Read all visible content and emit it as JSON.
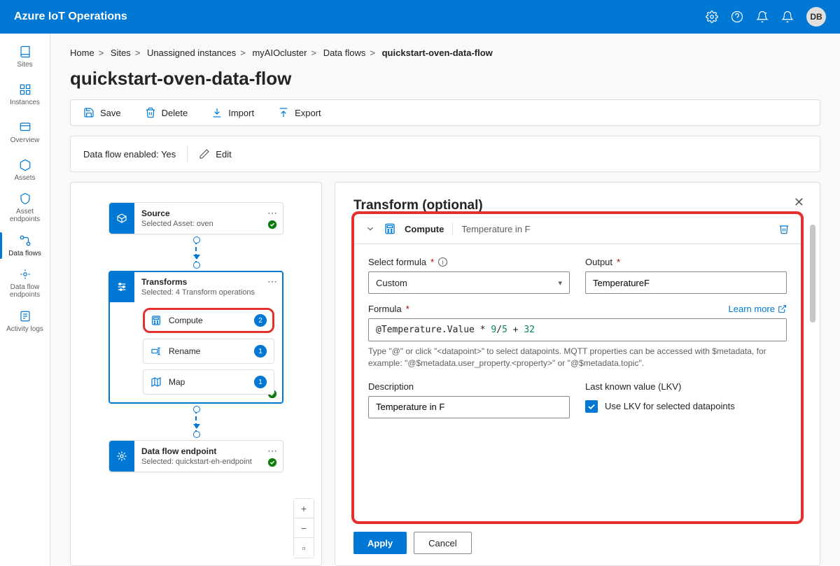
{
  "app_title": "Azure IoT Operations",
  "avatar_initials": "DB",
  "nav": [
    {
      "label": "Sites",
      "icon": "book"
    },
    {
      "label": "Instances",
      "icon": "grid"
    },
    {
      "label": "Overview",
      "icon": "overview"
    },
    {
      "label": "Assets",
      "icon": "asset"
    },
    {
      "label": "Asset endpoints",
      "icon": "asset-ep"
    },
    {
      "label": "Data flows",
      "icon": "flow",
      "active": true
    },
    {
      "label": "Data flow endpoints",
      "icon": "flow-ep"
    },
    {
      "label": "Activity logs",
      "icon": "logs"
    }
  ],
  "breadcrumbs": [
    "Home",
    "Sites",
    "Unassigned instances",
    "myAIOcluster",
    "Data flows"
  ],
  "breadcrumb_current": "quickstart-oven-data-flow",
  "page_title": "quickstart-oven-data-flow",
  "toolbar": {
    "save": "Save",
    "delete": "Delete",
    "import": "Import",
    "export": "Export"
  },
  "infobar": {
    "enabled_label": "Data flow enabled:",
    "enabled_value": "Yes",
    "edit": "Edit"
  },
  "nodes": {
    "source": {
      "title": "Source",
      "sub": "Selected Asset: oven"
    },
    "transforms": {
      "title": "Transforms",
      "sub": "Selected: 4 Transform operations",
      "children": [
        {
          "label": "Compute",
          "count": "2",
          "icon": "compute",
          "highlight": true
        },
        {
          "label": "Rename",
          "count": "1",
          "icon": "rename"
        },
        {
          "label": "Map",
          "count": "1",
          "icon": "map"
        }
      ]
    },
    "endpoint": {
      "title": "Data flow endpoint",
      "sub": "Selected: quickstart-eh-endpoint"
    }
  },
  "panel": {
    "title": "Transform (optional)",
    "section_label": "Compute",
    "section_desc": "Temperature in F",
    "select_formula_label": "Select formula",
    "select_formula_value": "Custom",
    "output_label": "Output",
    "output_value": "TemperatureF",
    "formula_label": "Formula",
    "formula_raw": "@Temperature.Value * 9/5 + 32",
    "learn_more": "Learn more",
    "hint": "Type \"@\" or click \"<datapoint>\" to select datapoints. MQTT properties can be accessed with $metadata, for example: \"@$metadata.user_property.<property>\" or \"@$metadata.topic\".",
    "description_label": "Description",
    "description_value": "Temperature in F",
    "lkv_heading": "Last known value (LKV)",
    "lkv_checkbox": "Use LKV for selected datapoints",
    "apply": "Apply",
    "cancel": "Cancel"
  }
}
